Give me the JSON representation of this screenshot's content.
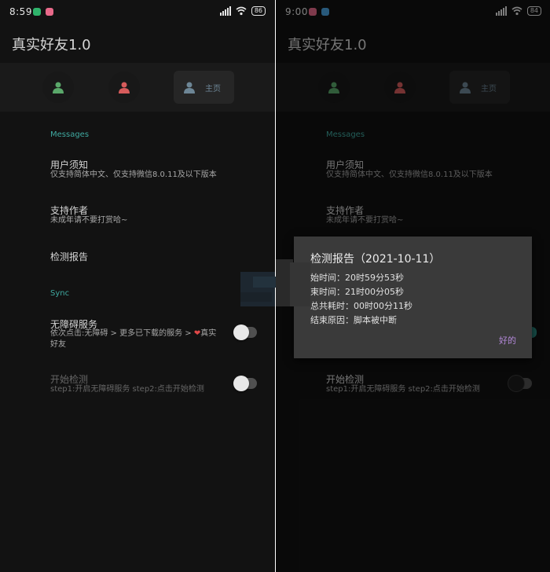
{
  "app_title": "真实好友1.0",
  "colors": {
    "background": "#121212",
    "tab_bar": "#1a1a1a",
    "section_header": "#3fa9a0",
    "friend_green": "#5aa86a",
    "friend_red": "#d65b5b",
    "home_blue": "#6d8696",
    "dialog_bg": "#3a3a3a",
    "dialog_button": "#b388d8"
  },
  "left": {
    "status": {
      "time": "8:59",
      "battery": "86"
    },
    "tabs": {
      "home_label": "主页"
    },
    "messages": {
      "header": "Messages",
      "notice_title": "用户须知",
      "notice_desc": "仅支持简体中文、仅支持微信8.0.11及以下版本",
      "support_title": "支持作者",
      "support_desc": "未成年请不要打赏哈~",
      "report_title": "检测报告"
    },
    "sync": {
      "header": "Sync",
      "a11y_title": "无障碍服务",
      "a11y_desc_1": "依次点击:无障碍 > 更多已下载的服务 > ",
      "a11y_desc_heart": "❤",
      "a11y_desc_2": "真实",
      "a11y_desc_3": "好友",
      "a11y_enabled": false,
      "start_title": "开始检测",
      "start_desc": "step1:开启无障碍服务 step2:点击开始检测",
      "start_enabled": false
    }
  },
  "right": {
    "status": {
      "time": "9:00",
      "battery": "84"
    },
    "tabs": {
      "home_label": "主页"
    },
    "messages": {
      "header": "Messages",
      "notice_title": "用户须知",
      "notice_desc": "仅支持简体中文、仅支持微信8.0.11及以下版本",
      "support_title": "支持作者",
      "support_desc": "未成年请不要打赏哈~"
    },
    "sync": {
      "start_title": "开始检测",
      "start_desc": "step1:开启无障碍服务 step2:点击开始检测",
      "start_enabled": false
    },
    "dialog": {
      "title": "检测报告（2021-10-11）",
      "line1": "始时间：20时59分53秒",
      "line2": "束时间：21时00分05秒",
      "line3": "总共耗时：00时00分11秒",
      "line4": "结束原因：脚本被中断",
      "ok_label": "好的"
    }
  }
}
